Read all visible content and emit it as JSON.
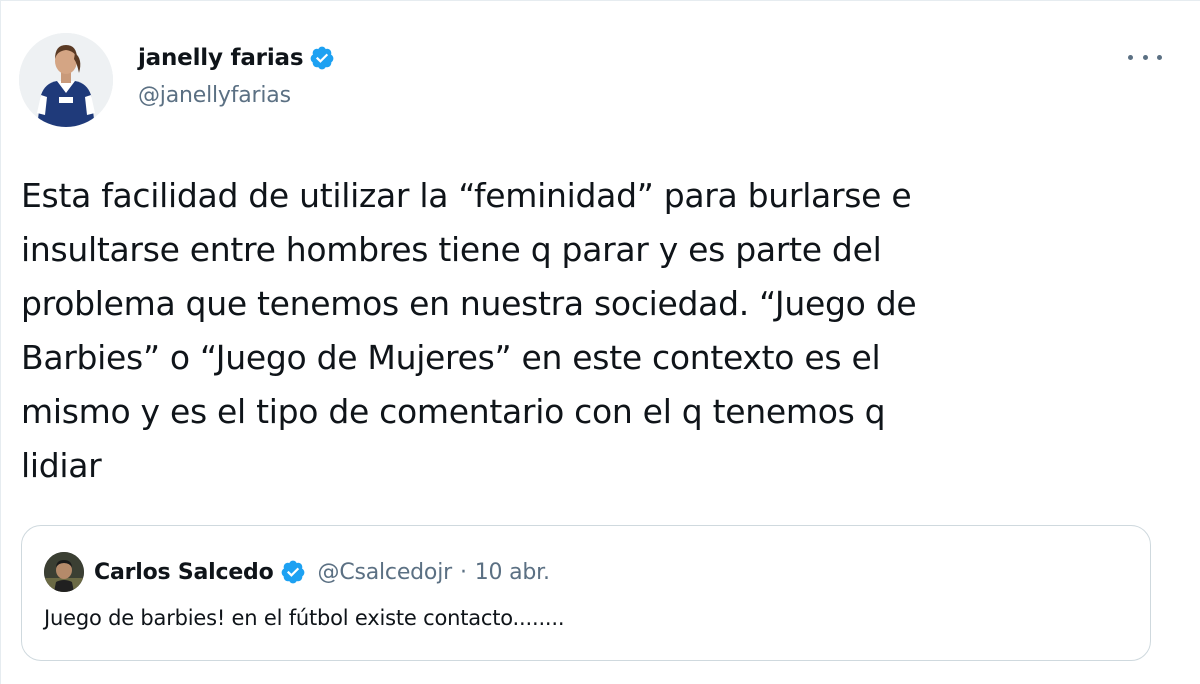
{
  "tweet": {
    "author": {
      "name": "janelly farias",
      "handle": "@janellyfarias",
      "verified": true
    },
    "text": "Esta facilidad de utilizar la “feminidad” para burlarse e\ninsultarse entre hombres tiene q parar y es parte del\nproblema que tenemos en nuestra sociedad. “Juego de\nBarbies” o “Juego de Mujeres” en este contexto es el\nmismo y es el tipo de comentario con el q tenemos q\nlidiar",
    "more_icon": "more-horizontal-icon"
  },
  "quoted_tweet": {
    "author": {
      "name": "Carlos Salcedo",
      "handle": "@Csalcedojr",
      "verified": true
    },
    "separator": "·",
    "date": "10 abr.",
    "text": "Juego de barbies! en el fútbol existe contacto........"
  },
  "colors": {
    "verified_blue": "#1da1f2",
    "secondary_text": "#5b7083",
    "border": "#cfd9de"
  }
}
